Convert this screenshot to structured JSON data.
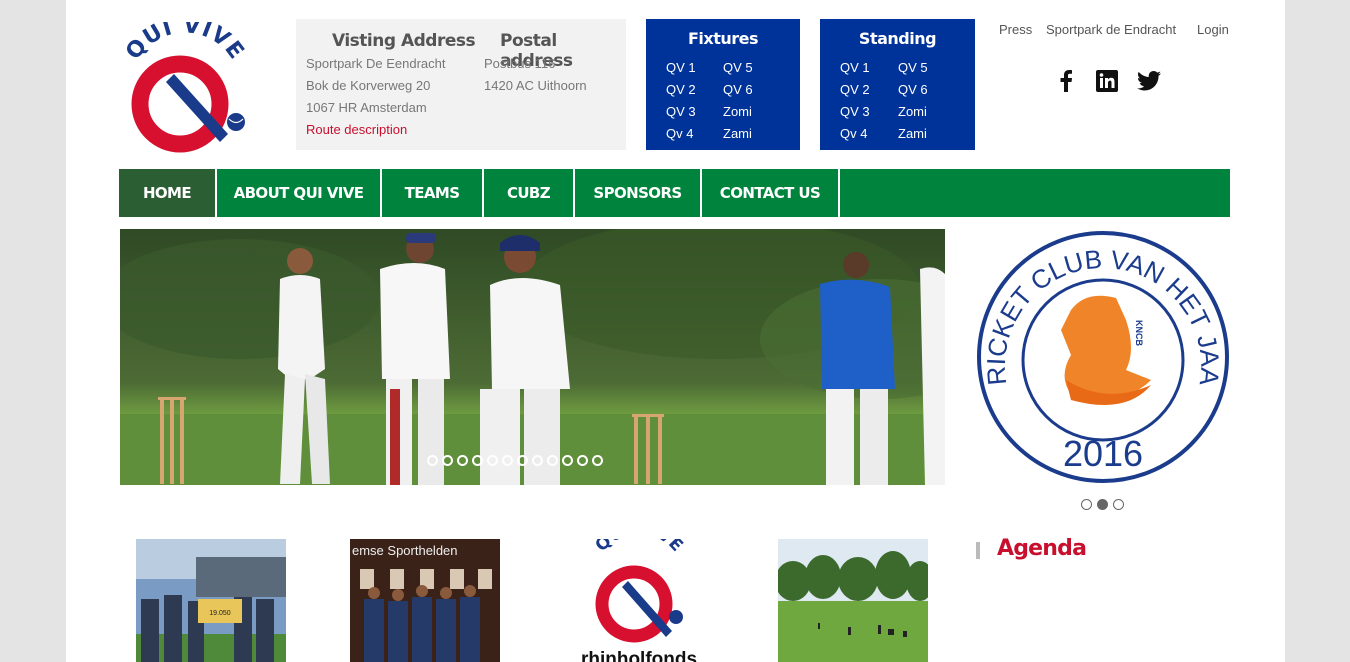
{
  "logo": {
    "text": "QUI VIVE"
  },
  "address": {
    "visiting_title": "Visting Address",
    "visiting_lines": [
      "Sportpark De Eendracht",
      "Bok de Korverweg 20",
      "1067 HR Amsterdam"
    ],
    "route_link": "Route description",
    "postal_title": "Postal address",
    "postal_lines": [
      "Postbus 116",
      "1420 AC Uithoorn"
    ]
  },
  "fixtures": {
    "title": "Fixtures",
    "items": [
      "QV 1",
      "QV 5",
      "QV 2",
      "QV 6",
      "QV 3",
      "Zomi",
      "Qv 4",
      "Zami"
    ]
  },
  "standing": {
    "title": "Standing",
    "items": [
      "QV 1",
      "QV 5",
      "QV 2",
      "QV 6",
      "QV 3",
      "Zomi",
      "Qv 4",
      "Zami"
    ]
  },
  "top_links": [
    "Press",
    "Sportpark de Endracht",
    "Login"
  ],
  "social": [
    "facebook-icon",
    "linkedin-icon",
    "twitter-icon"
  ],
  "nav": [
    "HOME",
    "ABOUT QUI VIVE",
    "TEAMS",
    "CUBZ",
    "SPONSORS",
    "CONTACT US"
  ],
  "side_badge": {
    "ring_text": "CRICKET CLUB VAN HET JAAR",
    "year": "2016",
    "org": "KNCB"
  },
  "thumbnails": {
    "sportheroes_caption": "emse Sporthelden",
    "rhinol_text": "rhinholfonds",
    "cheque_amount": "19.050"
  },
  "agenda": {
    "title": "Agenda"
  },
  "colors": {
    "blue": "#003399",
    "green": "#00843d",
    "red": "#c8102e",
    "nav_active": "#2c5e34"
  }
}
